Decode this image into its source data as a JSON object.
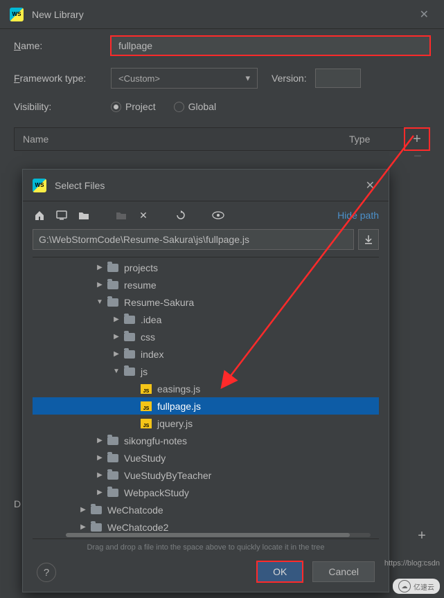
{
  "window": {
    "title": "New Library"
  },
  "form": {
    "name_label": "Name:",
    "name_value": "fullpage",
    "framework_label": "Framework type:",
    "framework_value": "<Custom>",
    "version_label": "Version:",
    "version_value": "",
    "visibility_label": "Visibility:",
    "radio_project": "Project",
    "radio_global": "Global"
  },
  "table": {
    "col_name": "Name",
    "col_type": "Type"
  },
  "d_label": "D",
  "dialog": {
    "title": "Select Files",
    "hide_path": "Hide path",
    "path": "G:\\WebStormCode\\Resume-Sakura\\js\\fullpage.js",
    "tree": [
      {
        "depth": 3,
        "kind": "folder",
        "toggle": "▶",
        "label": "projects"
      },
      {
        "depth": 3,
        "kind": "folder",
        "toggle": "▶",
        "label": "resume"
      },
      {
        "depth": 3,
        "kind": "folder",
        "toggle": "▼",
        "label": "Resume-Sakura"
      },
      {
        "depth": 4,
        "kind": "folder",
        "toggle": "▶",
        "label": ".idea"
      },
      {
        "depth": 4,
        "kind": "folder",
        "toggle": "▶",
        "label": "css"
      },
      {
        "depth": 4,
        "kind": "folder",
        "toggle": "▶",
        "label": "index"
      },
      {
        "depth": 4,
        "kind": "folder",
        "toggle": "▼",
        "label": "js"
      },
      {
        "depth": 5,
        "kind": "js",
        "toggle": "",
        "label": "easings.js"
      },
      {
        "depth": 5,
        "kind": "js",
        "toggle": "",
        "label": "fullpage.js",
        "selected": true
      },
      {
        "depth": 5,
        "kind": "js",
        "toggle": "",
        "label": "jquery.js"
      },
      {
        "depth": 3,
        "kind": "folder",
        "toggle": "▶",
        "label": "sikongfu-notes"
      },
      {
        "depth": 3,
        "kind": "folder",
        "toggle": "▶",
        "label": "VueStudy"
      },
      {
        "depth": 3,
        "kind": "folder",
        "toggle": "▶",
        "label": "VueStudyByTeacher"
      },
      {
        "depth": 3,
        "kind": "folder",
        "toggle": "▶",
        "label": "WebpackStudy"
      },
      {
        "depth": 2,
        "kind": "folder",
        "toggle": "▶",
        "label": "WeChatcode"
      },
      {
        "depth": 2,
        "kind": "folder",
        "toggle": "▶",
        "label": "WeChatcode2"
      }
    ],
    "hint": "Drag and drop a file into the space above to quickly locate it in the tree",
    "ok": "OK",
    "cancel": "Cancel"
  },
  "watermark": {
    "brand": "亿速云",
    "url": "https://blog.csdn"
  }
}
